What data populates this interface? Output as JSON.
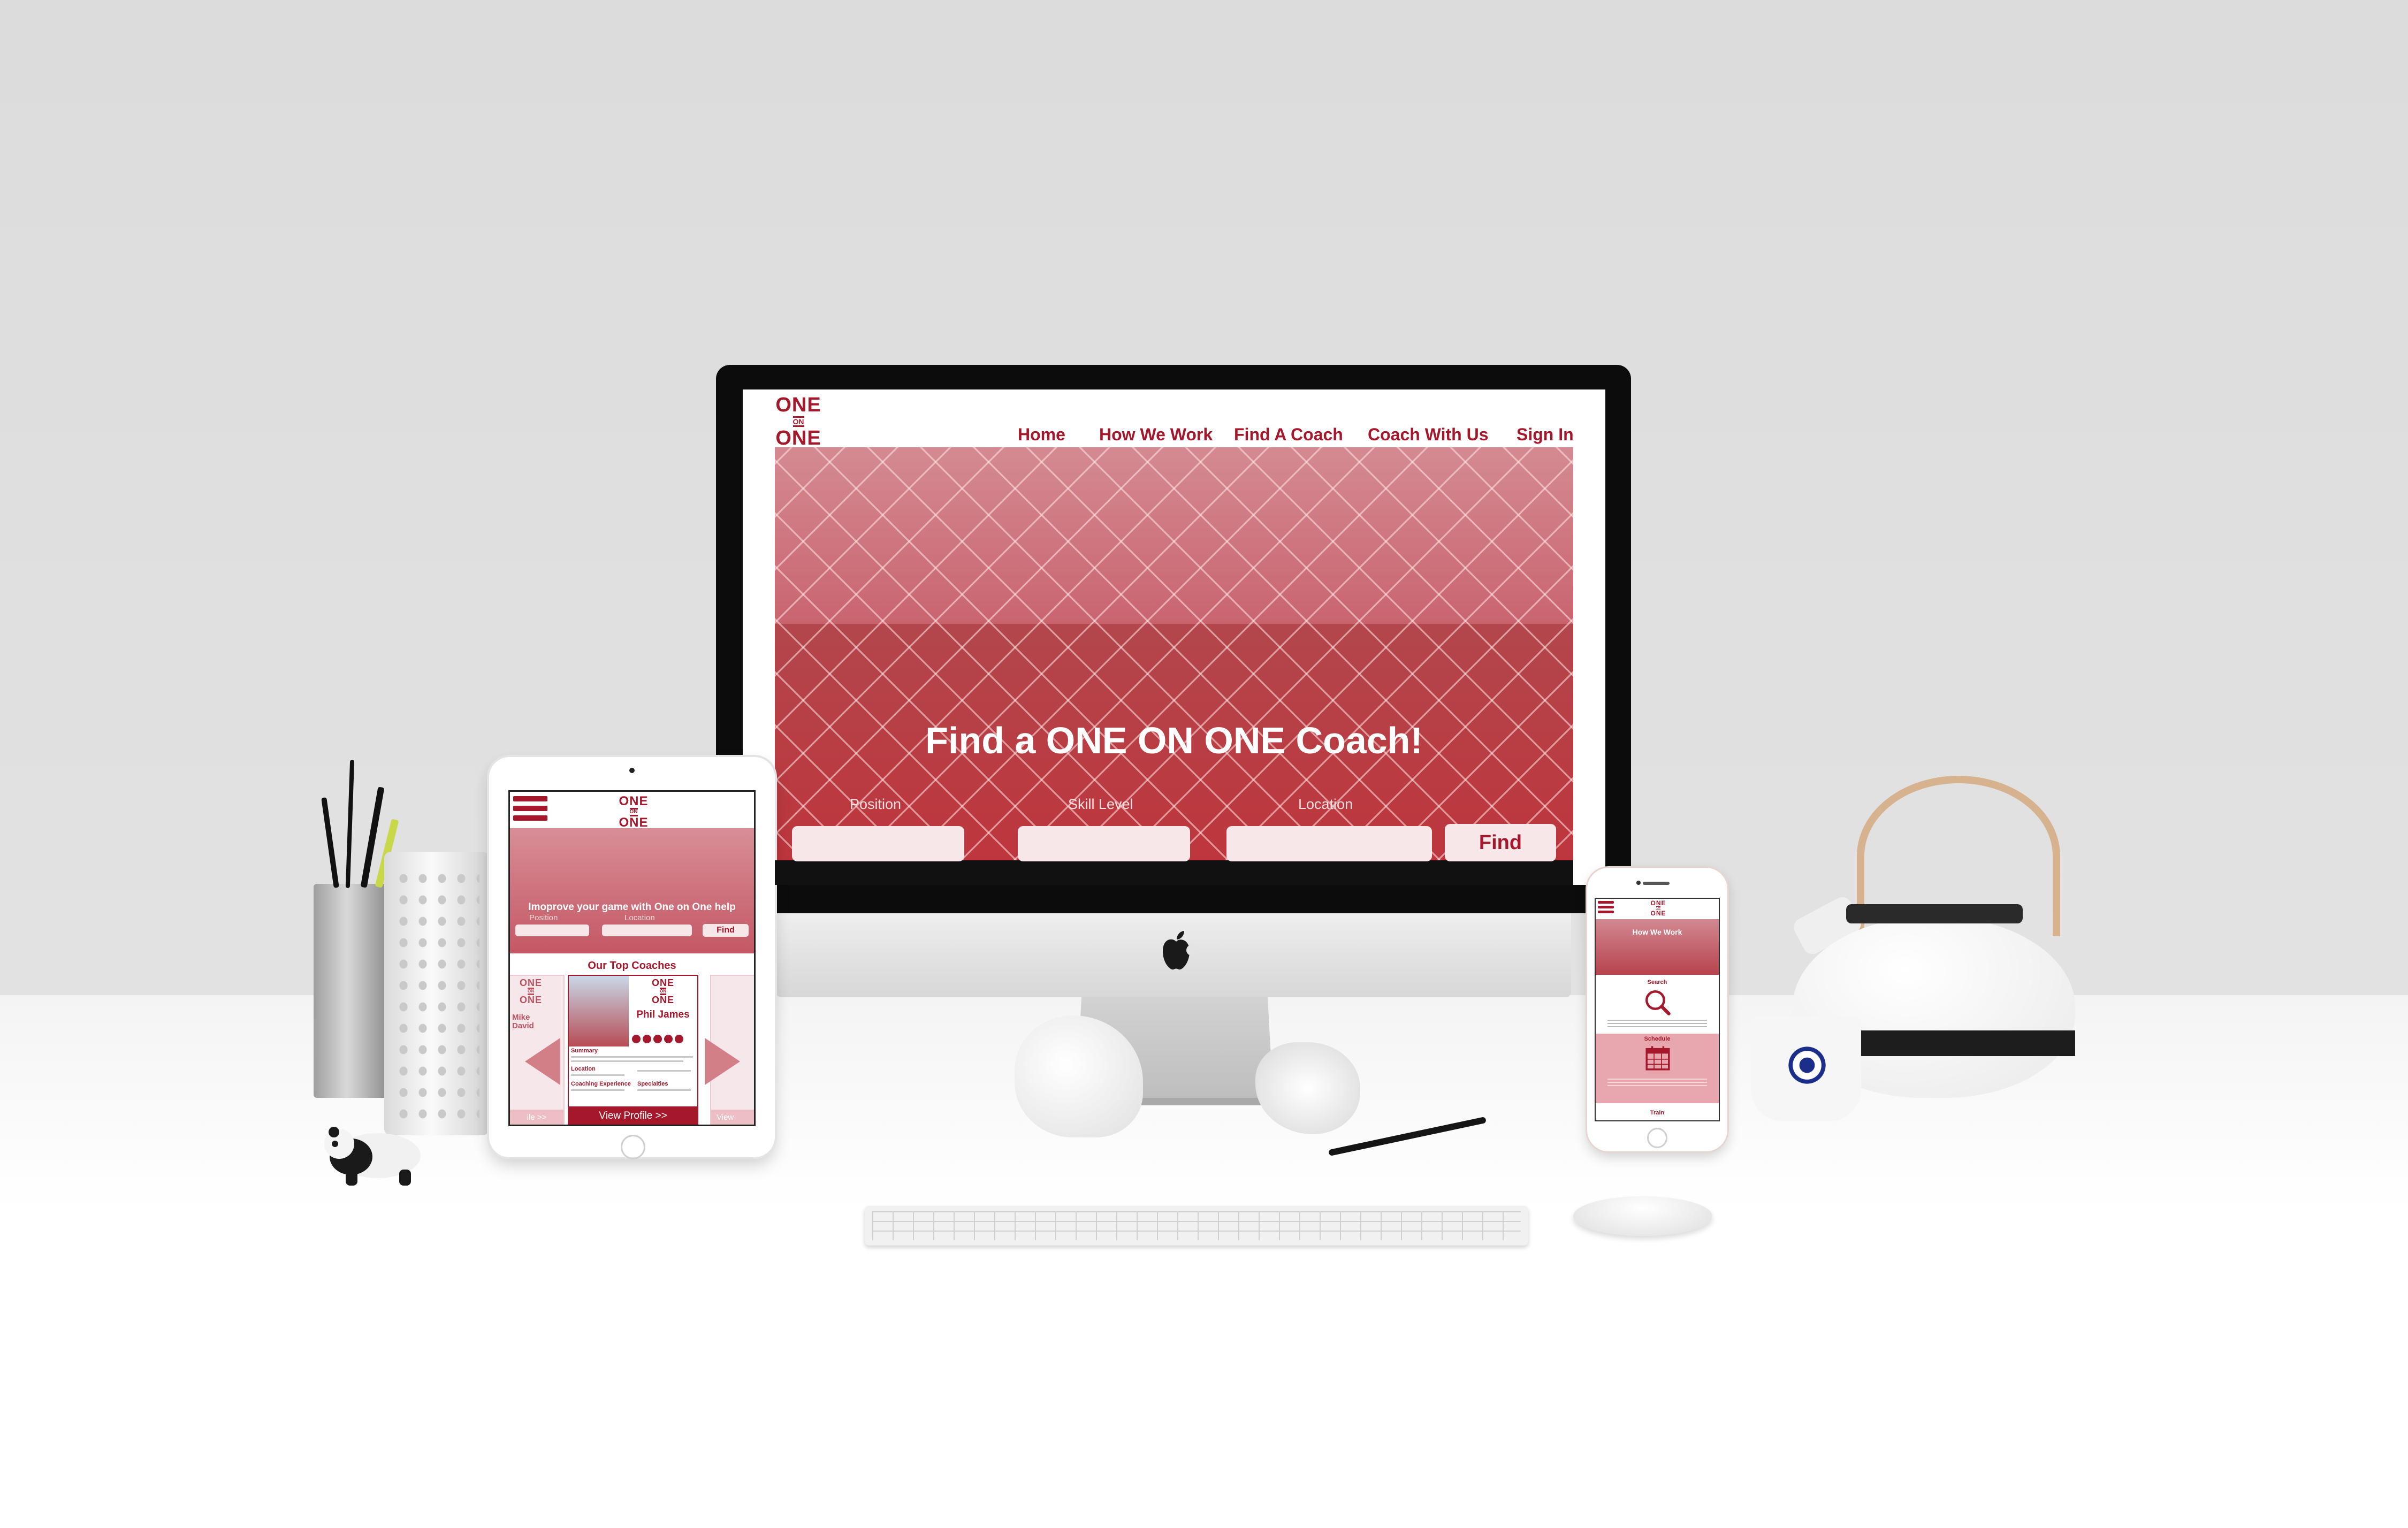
{
  "desktop": {
    "logo": {
      "top": "ONE",
      "middle": "ON",
      "bottom": "ONE"
    },
    "nav": [
      "Home",
      "How We Work",
      "Find A Coach",
      "Coach With Us",
      "Sign In"
    ],
    "hero_title": "Find a ONE ON ONE Coach!",
    "search": {
      "position_label": "Position",
      "skill_label": "Skill Level",
      "location_label": "Location",
      "find_label": "Find"
    }
  },
  "tablet": {
    "logo": {
      "top": "ONE",
      "middle": "ON",
      "bottom": "ONE"
    },
    "tagline": "Imoprove your game with One on One help",
    "position_label": "Position",
    "location_label": "Location",
    "find_label": "Find",
    "section_title": "Our Top Coaches",
    "card": {
      "logo": {
        "top": "ONE",
        "middle": "ON",
        "bottom": "ONE"
      },
      "name": "Phil James",
      "summary_label": "Summary",
      "location_label": "Location",
      "experience_label": "Coaching Experience",
      "specialties_label": "Specialties",
      "view_profile": "View Profile >>"
    },
    "left_card": {
      "logo": {
        "top": "ONE",
        "middle": "ON",
        "bottom": "ONE"
      },
      "name": "Mike David",
      "footer": "ile >>"
    },
    "right_card": {
      "footer": "View"
    }
  },
  "phone": {
    "logo": {
      "top": "ONE",
      "middle": "ON",
      "bottom": "ONE"
    },
    "title": "How We Work",
    "step1": "Search",
    "step2": "Schedule",
    "step3": "Train"
  },
  "colors": {
    "brand": "#a5182b",
    "hero_tint": "#c8606b",
    "field": "#f7e7e9"
  },
  "icons": [
    "apple-logo",
    "hamburger-menu-icon",
    "magnifier-icon",
    "calendar-icon",
    "arrow-left-icon",
    "arrow-right-icon"
  ]
}
